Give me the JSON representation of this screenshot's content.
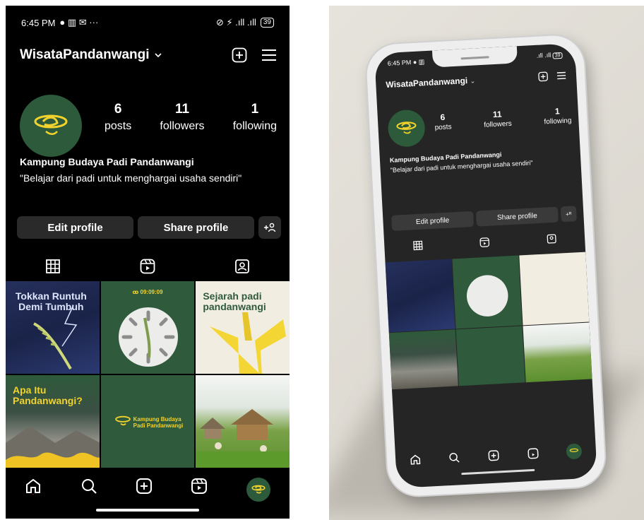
{
  "status": {
    "time": "6:45 PM",
    "left_icons": "● ▥ ✉ ···",
    "right_icons": "⊘ ⚡ .ıll .ıll",
    "battery": "39"
  },
  "profile": {
    "username": "WisataPandanwangi",
    "posts_count": "6",
    "posts_label": "posts",
    "followers_count": "11",
    "followers_label": "followers",
    "following_count": "1",
    "following_label": "following",
    "name": "Kampung Budaya Padi Pandanwangi",
    "bio": "\"Belajar dari padi untuk menghargai usaha sendiri\""
  },
  "buttons": {
    "edit_profile": "Edit profile",
    "share_profile": "Share profile",
    "add_person": "+ᴿ"
  },
  "posts": [
    {
      "text": "Tokkan Runtuh Demi Tumbuh"
    },
    {
      "text": "ꝏ 09:09:09"
    },
    {
      "text": "Sejarah padi pandanwangi"
    },
    {
      "text": "Apa Itu Pandanwangi?"
    },
    {
      "text": "Kampung Budaya Padi Pandanwangi"
    },
    {
      "text": ""
    }
  ],
  "mockup": {
    "time": "6:45 PM ● ▥",
    "signal": ".ıll .ıll",
    "battery": "39"
  },
  "colors": {
    "brand_green": "#2d5a3a",
    "logo_yellow": "#f2d22c",
    "background": "#000000"
  }
}
